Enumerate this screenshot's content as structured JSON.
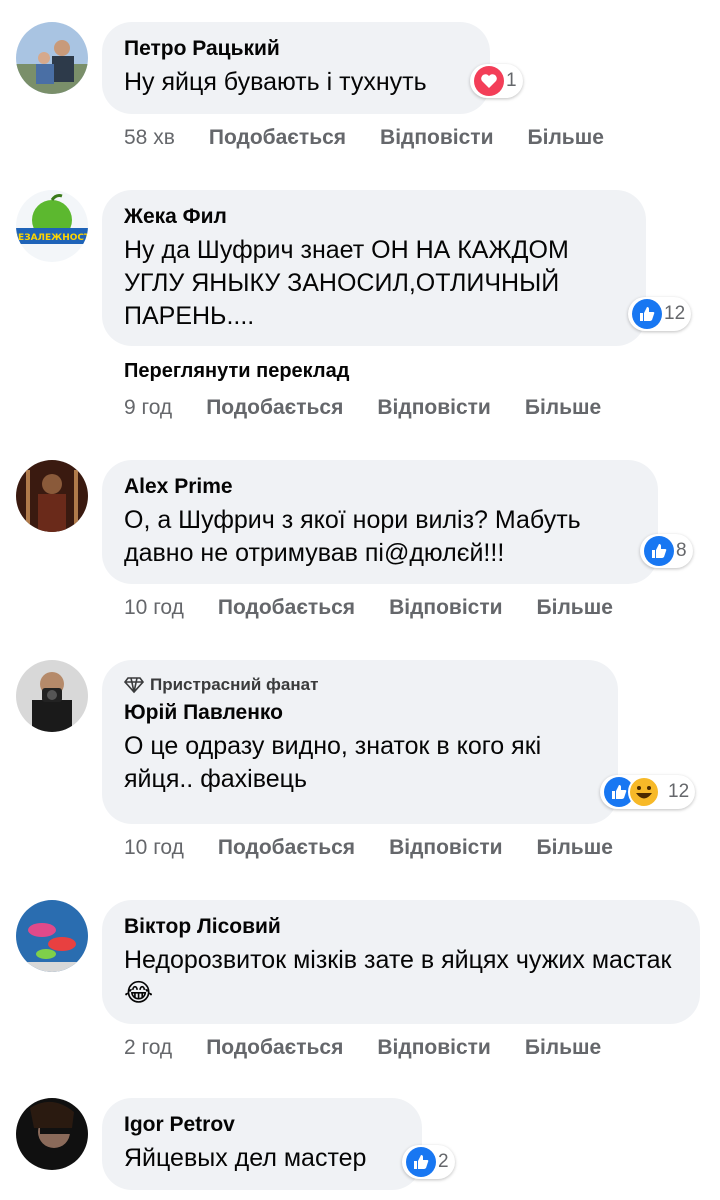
{
  "actions": {
    "like": "Подобається",
    "reply": "Відповісти",
    "more": "Більше"
  },
  "comments": [
    {
      "author": "Петро Рацький",
      "text": "Ну яйця бувають і тухнуть",
      "time": "58 хв",
      "reaction_count": "1",
      "reaction": "heart-icon"
    },
    {
      "author": "Жека Фил",
      "text": "Ну да Шуфрич знает ОН НА КАЖДОМ УГЛУ ЯНЫКУ ЗАНОСИЛ,ОТЛИЧНЫЙ ПАРЕНЬ....",
      "time": "9 год",
      "reaction_count": "12",
      "reaction": "like-icon",
      "translate": "Переглянути переклад",
      "avatar_text": "НЕЗАЛЕЖНОСТІ"
    },
    {
      "author": "Alex Prime",
      "text": "О, а Шуфрич з якої нори виліз? Мабуть давно не отримував пі@дюлєй!!!",
      "time": "10 год",
      "reaction_count": "8",
      "reaction": "like-icon"
    },
    {
      "author": "Юрій Павленко",
      "badge": "Пристрасний фанат",
      "text": "О це одразу видно, знаток в кого які яйця.. фахівець",
      "time": "10 год",
      "reaction_count": "12",
      "reaction": "like-haha-icons"
    },
    {
      "author": "Віктор Лісовий",
      "text": "Недорозвиток мізків зате в яйцях чужих мастак",
      "emoji": "😂",
      "time": "2 год",
      "reaction_count": "",
      "reaction": ""
    },
    {
      "author": "Igor Petrov",
      "text": "Яйцевых дел мастер",
      "time": "",
      "reaction_count": "2",
      "reaction": "like-icon"
    }
  ],
  "colors": {
    "like": "#1877f2",
    "heart": "#f33e58",
    "haha": "#f7b928",
    "bubble": "#f0f2f5",
    "meta": "#65676b"
  }
}
